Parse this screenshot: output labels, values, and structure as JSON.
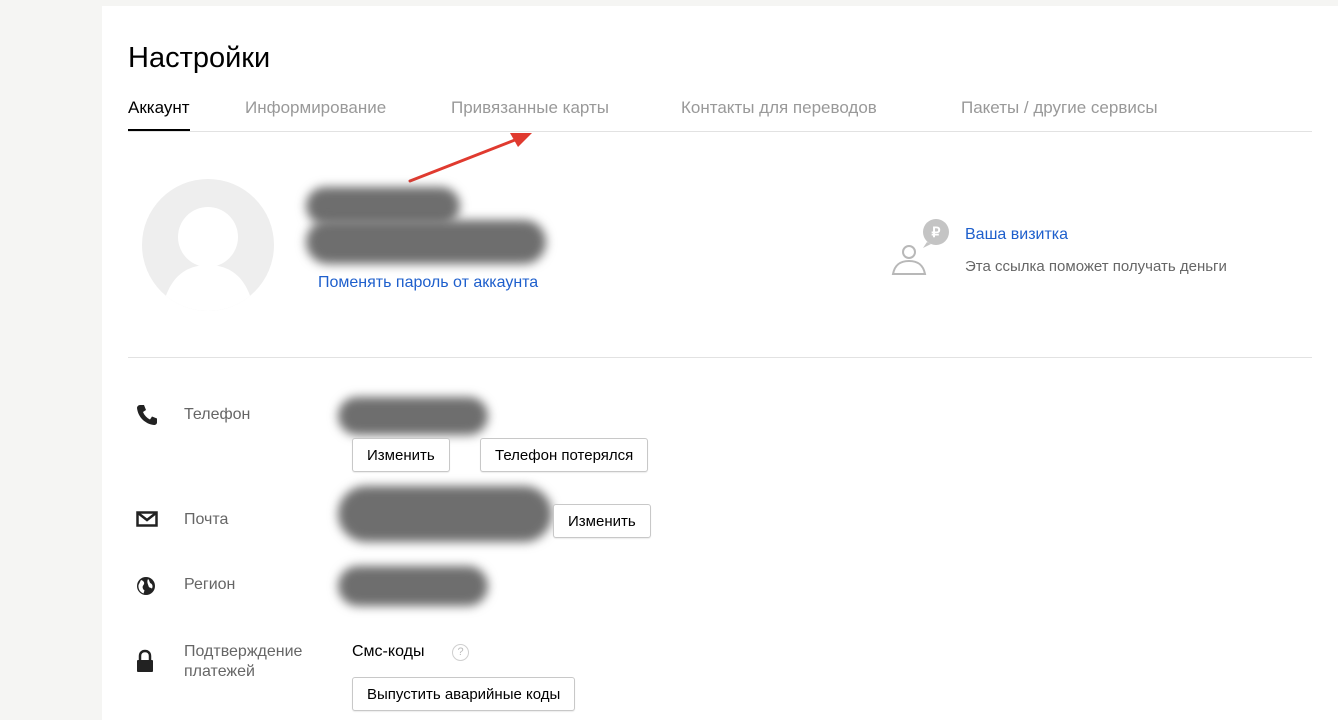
{
  "header": {
    "title": "Настройки"
  },
  "tabs": [
    {
      "label": "Аккаунт",
      "active": true
    },
    {
      "label": "Информирование",
      "active": false
    },
    {
      "label": "Привязанные карты",
      "active": false
    },
    {
      "label": "Контакты для переводов",
      "active": false
    },
    {
      "label": "Пакеты / другие сервисы",
      "active": false
    }
  ],
  "profile": {
    "change_password_link": "Поменять пароль от аккаунта"
  },
  "business_card": {
    "title": "Ваша визитка",
    "subtitle": "Эта ссылка поможет получать деньги",
    "icon": "person-ruble-icon",
    "currency_symbol": "₽"
  },
  "rows": {
    "phone": {
      "label": "Телефон",
      "icon": "phone-icon",
      "buttons": [
        "Изменить",
        "Телефон потерялся"
      ]
    },
    "email": {
      "label": "Почта",
      "icon": "envelope-icon",
      "button": "Изменить"
    },
    "region": {
      "label": "Регион",
      "icon": "globe-icon"
    },
    "payment": {
      "label_line1": "Подтверждение",
      "label_line2": "платежей",
      "icon": "lock-icon",
      "value": "Смс-коды",
      "help_symbol": "?",
      "button": "Выпустить аварийные коды"
    }
  },
  "colors": {
    "link": "#1e5fcc",
    "arrow": "#e03a2f",
    "muted_text": "#999999"
  }
}
